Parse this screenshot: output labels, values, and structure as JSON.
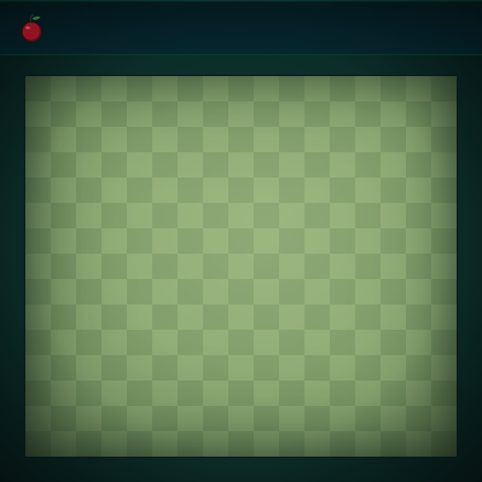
{
  "game": {
    "apple_count": "",
    "colors": {
      "background": "#0a2423",
      "top_bar": "#05222a",
      "board_dark": "#7c9a66",
      "board_light": "#8daa73",
      "apple_red": "#c0182a",
      "leaf_green": "#3f8f3a"
    },
    "icons": {
      "score_icon": "apple-icon"
    }
  }
}
